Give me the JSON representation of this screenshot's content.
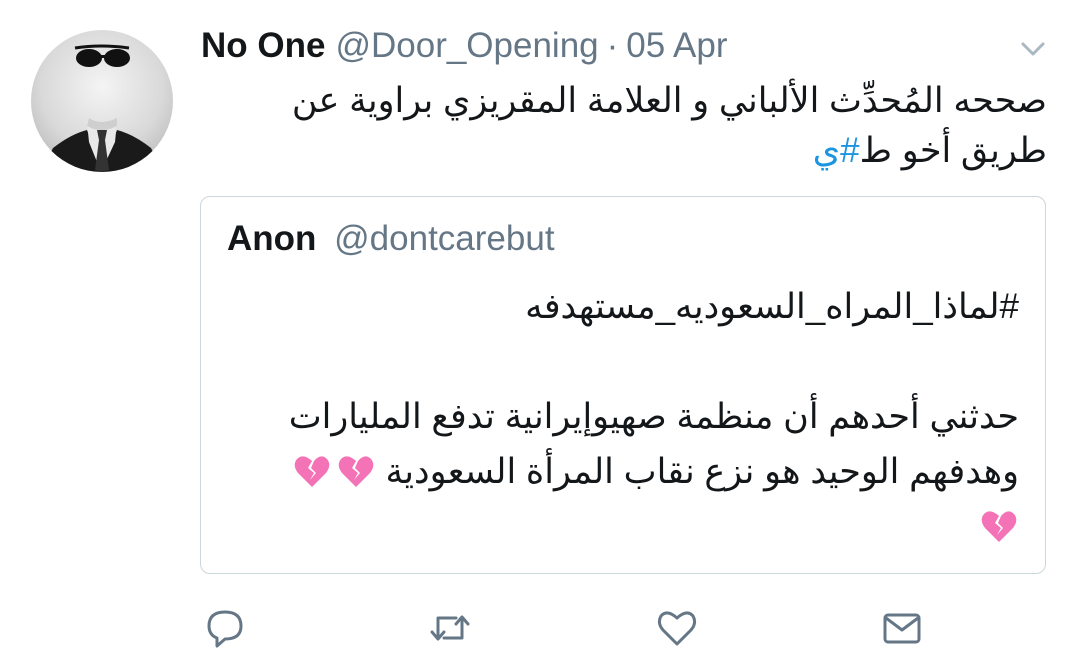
{
  "tweet": {
    "display_name": "No One",
    "handle": "@Door_Opening",
    "separator": "·",
    "date": "05 Apr",
    "text_main": "صححه المُحدِّث الألباني و العلامة المقريزي براوية عن طريق أخو ط",
    "hashtag": "#ي"
  },
  "quote": {
    "display_name": "Anon",
    "handle": "@dontcarebut",
    "line1": "#لماذا_المراه_السعوديه_مستهدفه",
    "line2": "حدثني أحدهم أن منظمة صهيوإيرانية تدفع المليارات",
    "line3": "وهدفهم الوحيد هو نزع نقاب المرأة السعودية"
  },
  "icons": {
    "avatar": "invisible-man-avatar",
    "caret": "chevron-down-icon",
    "emoji": "broken-heart-icon",
    "reply": "reply-icon",
    "retweet": "retweet-icon",
    "like": "heart-icon",
    "message": "envelope-icon"
  },
  "colors": {
    "text": "#14171a",
    "secondary": "#657786",
    "link": "#1b95e0",
    "border": "#ccd6dd",
    "broken_heart": "#f472b6"
  }
}
